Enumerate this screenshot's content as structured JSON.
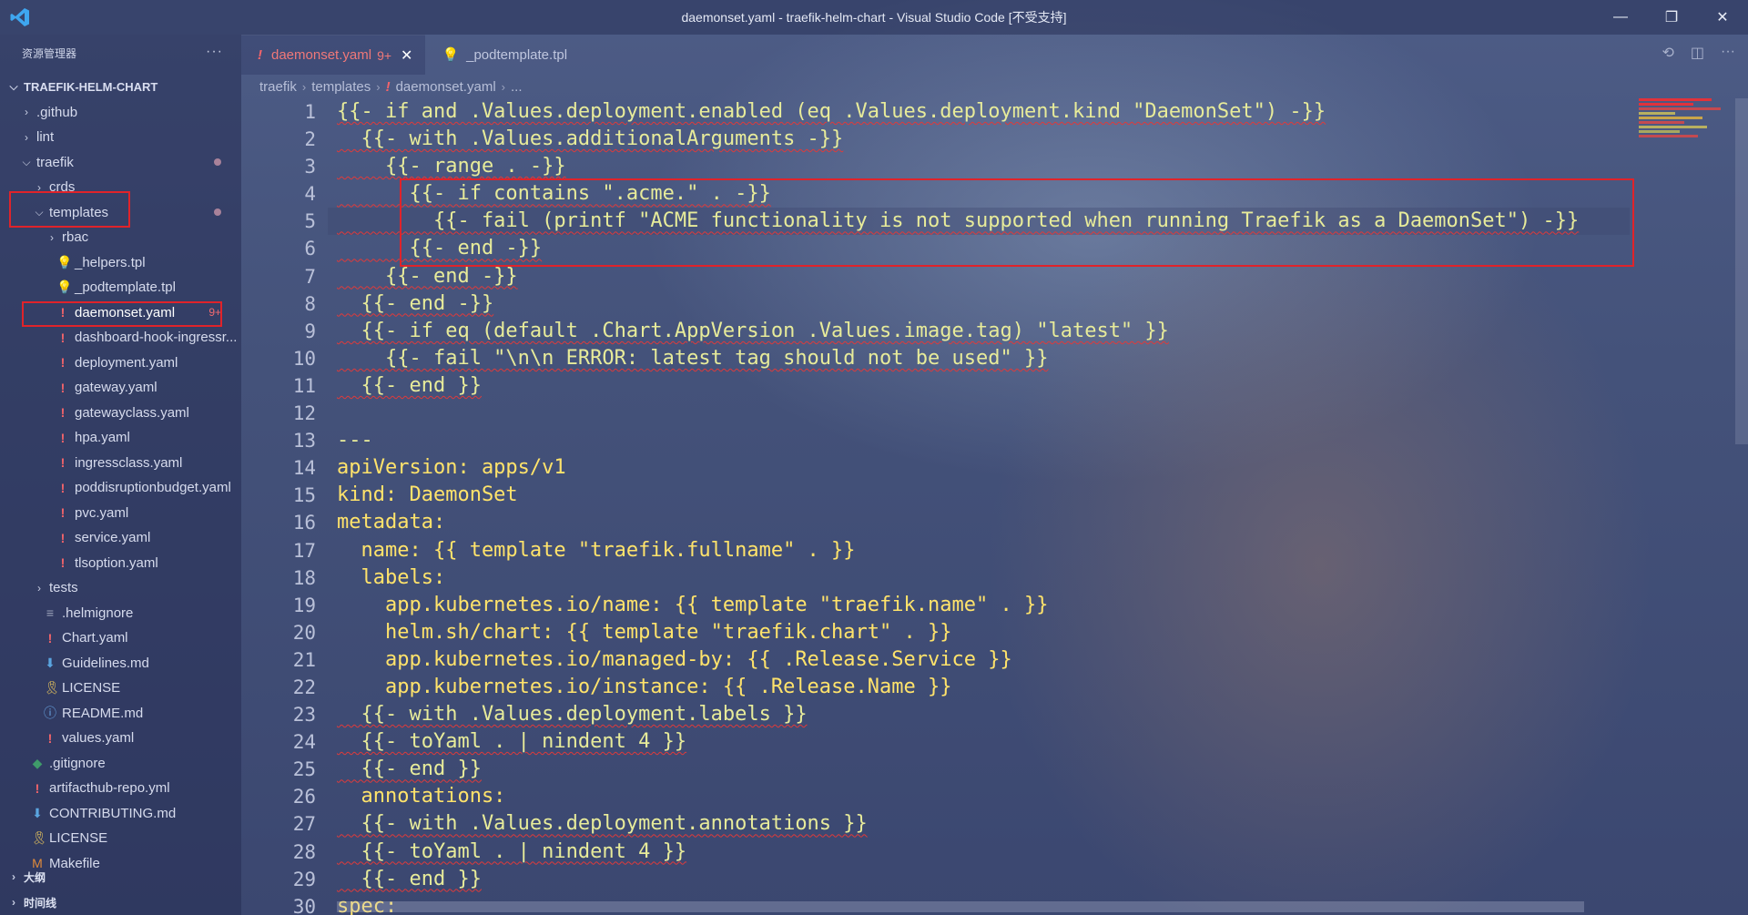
{
  "window": {
    "title": "daemonset.yaml - traefik-helm-chart - Visual Studio Code [不受支持]",
    "minimize": "—",
    "restore": "❐",
    "close": "✕"
  },
  "sidebar": {
    "title": "资源管理器",
    "more": "···",
    "root": "TRAEFIK-HELM-CHART",
    "items": [
      {
        "label": ".github",
        "type": "folder",
        "depth": 1,
        "open": false
      },
      {
        "label": "lint",
        "type": "folder",
        "depth": 1,
        "open": false
      },
      {
        "label": "traefik",
        "type": "folder",
        "depth": 1,
        "open": true,
        "dot": true
      },
      {
        "label": "crds",
        "type": "folder",
        "depth": 2,
        "open": false
      },
      {
        "label": "templates",
        "type": "folder",
        "depth": 2,
        "open": true,
        "dot": true
      },
      {
        "label": "rbac",
        "type": "folder",
        "depth": 3,
        "open": false
      },
      {
        "label": "_helpers.tpl",
        "type": "tpl",
        "depth": 3
      },
      {
        "label": "_podtemplate.tpl",
        "type": "tpl",
        "depth": 3
      },
      {
        "label": "daemonset.yaml",
        "type": "yaml",
        "depth": 3,
        "badge": "9+"
      },
      {
        "label": "dashboard-hook-ingressr...",
        "type": "yaml",
        "depth": 3
      },
      {
        "label": "deployment.yaml",
        "type": "yaml",
        "depth": 3
      },
      {
        "label": "gateway.yaml",
        "type": "yaml",
        "depth": 3
      },
      {
        "label": "gatewayclass.yaml",
        "type": "yaml",
        "depth": 3
      },
      {
        "label": "hpa.yaml",
        "type": "yaml",
        "depth": 3
      },
      {
        "label": "ingressclass.yaml",
        "type": "yaml",
        "depth": 3
      },
      {
        "label": "poddisruptionbudget.yaml",
        "type": "yaml",
        "depth": 3
      },
      {
        "label": "pvc.yaml",
        "type": "yaml",
        "depth": 3
      },
      {
        "label": "service.yaml",
        "type": "yaml",
        "depth": 3
      },
      {
        "label": "tlsoption.yaml",
        "type": "yaml",
        "depth": 3
      },
      {
        "label": "tests",
        "type": "folder",
        "depth": 2,
        "open": false
      },
      {
        "label": ".helmignore",
        "type": "ign",
        "depth": 2
      },
      {
        "label": "Chart.yaml",
        "type": "yaml",
        "depth": 2
      },
      {
        "label": "Guidelines.md",
        "type": "md",
        "depth": 2
      },
      {
        "label": "LICENSE",
        "type": "lic",
        "depth": 2
      },
      {
        "label": "README.md",
        "type": "info",
        "depth": 2
      },
      {
        "label": "values.yaml",
        "type": "yaml",
        "depth": 2
      },
      {
        "label": ".gitignore",
        "type": "git",
        "depth": 1
      },
      {
        "label": "artifacthub-repo.yml",
        "type": "yaml",
        "depth": 1
      },
      {
        "label": "CONTRIBUTING.md",
        "type": "md",
        "depth": 1
      },
      {
        "label": "LICENSE",
        "type": "lic",
        "depth": 1
      },
      {
        "label": "Makefile",
        "type": "make",
        "depth": 1
      }
    ],
    "outline": "大纲",
    "timeline": "时间线"
  },
  "tabs": [
    {
      "label": "daemonset.yaml",
      "count": "9+",
      "active": true,
      "close": "✕"
    },
    {
      "label": "_podtemplate.tpl",
      "active": false
    }
  ],
  "breadcrumb": [
    "traefik",
    "templates",
    "daemonset.yaml",
    "..."
  ],
  "editor": {
    "lines": [
      "{{- if and .Values.deployment.enabled (eq .Values.deployment.kind \"DaemonSet\") -}}",
      "  {{- with .Values.additionalArguments -}}",
      "    {{- range . -}}",
      "      {{- if contains \".acme.\" . -}}",
      "        {{- fail (printf \"ACME functionality is not supported when running Traefik as a DaemonSet\") -}}",
      "      {{- end -}}",
      "    {{- end -}}",
      "  {{- end -}}",
      "  {{- if eq (default .Chart.AppVersion .Values.image.tag) \"latest\" }}",
      "    {{- fail \"\\n\\n ERROR: latest tag should not be used\" }}",
      "  {{- end }}",
      "",
      "---",
      "apiVersion: apps/v1",
      "kind: DaemonSet",
      "metadata:",
      "  name: {{ template \"traefik.fullname\" . }}",
      "  labels:",
      "    app.kubernetes.io/name: {{ template \"traefik.name\" . }}",
      "    helm.sh/chart: {{ template \"traefik.chart\" . }}",
      "    app.kubernetes.io/managed-by: {{ .Release.Service }}",
      "    app.kubernetes.io/instance: {{ .Release.Name }}",
      "  {{- with .Values.deployment.labels }}",
      "  {{- toYaml . | nindent 4 }}",
      "  {{- end }}",
      "  annotations:",
      "  {{- with .Values.deployment.annotations }}",
      "  {{- toYaml . | nindent 4 }}",
      "  {{- end }}",
      "spec:"
    ]
  }
}
